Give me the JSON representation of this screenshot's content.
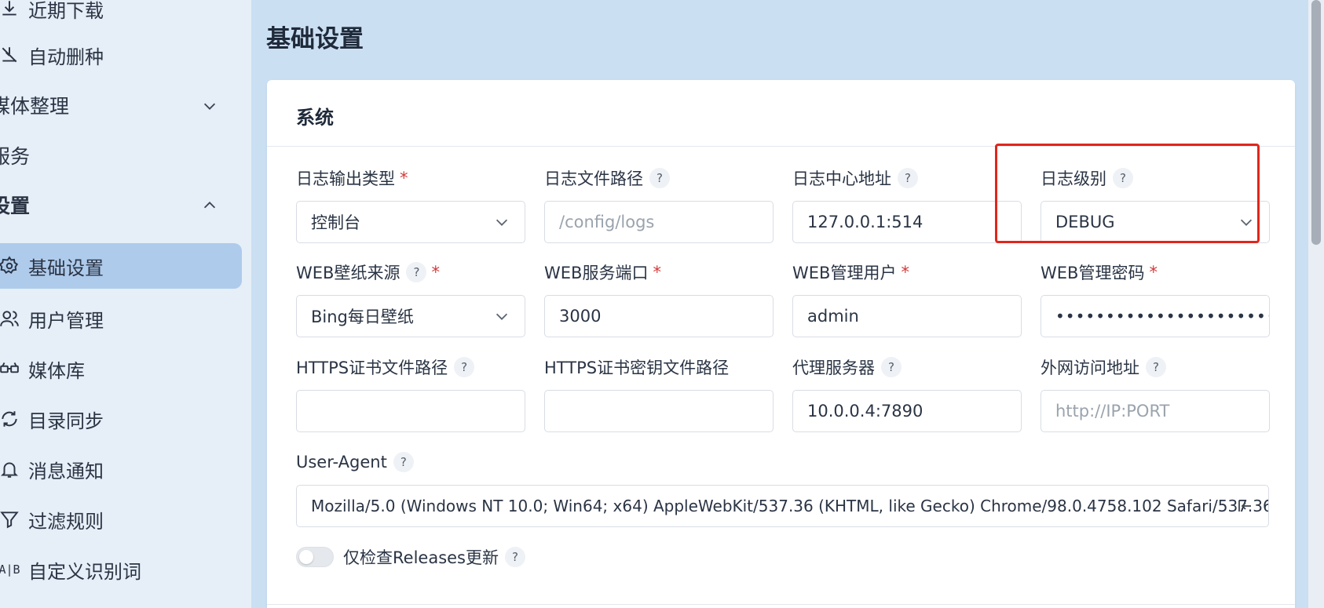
{
  "sidebar": {
    "items": [
      {
        "label": "近期下载",
        "icon": "download-icon"
      },
      {
        "label": "自动删种",
        "icon": "auto-delete-icon"
      },
      {
        "label": "媒体整理",
        "icon": "",
        "chevron": "down"
      },
      {
        "label": "服务",
        "icon": ""
      },
      {
        "label": "设置",
        "icon": "",
        "chevron": "up"
      },
      {
        "label": "基础设置",
        "icon": "gear-icon",
        "active": true
      },
      {
        "label": "用户管理",
        "icon": "users-icon"
      },
      {
        "label": "媒体库",
        "icon": "glasses-icon"
      },
      {
        "label": "目录同步",
        "icon": "sync-icon"
      },
      {
        "label": "消息通知",
        "icon": "bell-icon"
      },
      {
        "label": "过滤规则",
        "icon": "filter-icon"
      },
      {
        "label": "自定义识别词",
        "icon": "ab-icon"
      }
    ]
  },
  "page": {
    "title": "基础设置"
  },
  "card": {
    "title": "系统",
    "fields": {
      "log_type": {
        "label": "日志输出类型",
        "value": "控制台"
      },
      "log_path": {
        "label": "日志文件路径",
        "placeholder": "/config/logs"
      },
      "log_center": {
        "label": "日志中心地址",
        "value": "127.0.0.1:514"
      },
      "log_level": {
        "label": "日志级别",
        "value": "DEBUG"
      },
      "wallpaper": {
        "label": "WEB壁纸来源",
        "value": "Bing每日壁纸"
      },
      "web_port": {
        "label": "WEB服务端口",
        "value": "3000"
      },
      "web_user": {
        "label": "WEB管理用户",
        "value": "admin"
      },
      "web_password": {
        "label": "WEB管理密码",
        "value": "••••••••••••••••••••••••••••••"
      },
      "https_cert": {
        "label": "HTTPS证书文件路径",
        "value": ""
      },
      "https_key": {
        "label": "HTTPS证书密钥文件路径",
        "value": ""
      },
      "proxy": {
        "label": "代理服务器",
        "value": "10.0.0.4:7890"
      },
      "external_url": {
        "label": "外网访问地址",
        "placeholder": "http://IP:PORT"
      },
      "user_agent": {
        "label": "User-Agent",
        "value": "Mozilla/5.0 (Windows NT 10.0; Win64; x64) AppleWebKit/537.36 (KHTML, like Gecko) Chrome/98.0.4758.102 Safari/537.36"
      }
    },
    "releases_switch": {
      "label": "仅检查Releases更新",
      "checked": false
    }
  },
  "help_symbol": "?",
  "required_symbol": "*",
  "colors": {
    "accent": "#aecbec",
    "required": "#d23a3a",
    "highlight": "#e1261c",
    "background": "#cbdff3"
  }
}
